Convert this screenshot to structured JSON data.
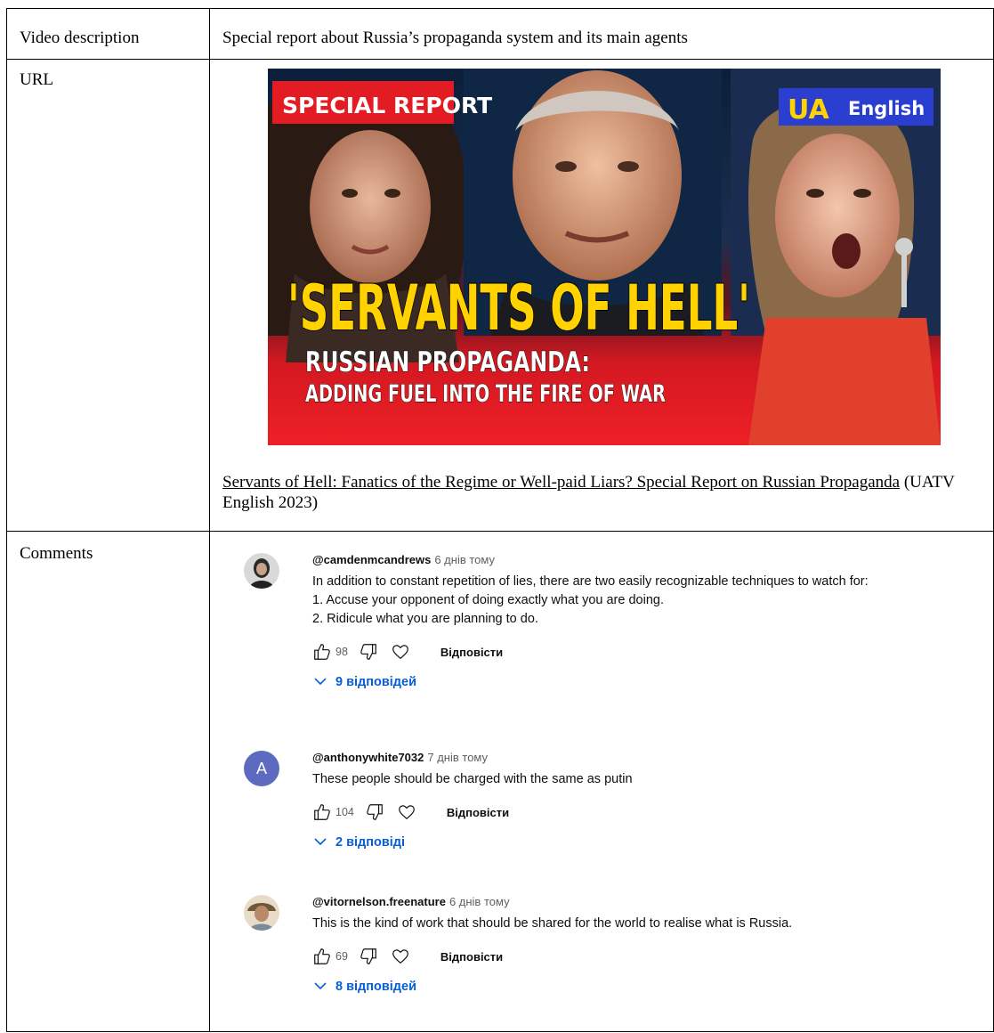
{
  "rows": {
    "description": {
      "label": "Video description",
      "value": "Special report about Russia’s propaganda system and its main agents"
    },
    "url": {
      "label": "URL",
      "thumbnail": {
        "badge": "SPECIAL REPORT",
        "logo_mark": "UA",
        "logo_text": "English",
        "headline": "'SERVANTS OF HELL'",
        "subline1": "RUSSIAN PROPAGANDA:",
        "subline2": "ADDING FUEL INTO THE FIRE OF WAR"
      },
      "citation_link": "Servants of Hell: Fanatics of the Regime or Well-paid Liars? Special Report on Russian Propaganda",
      "citation_rest": " (UATV English 2023)"
    },
    "comments": {
      "label": "Comments",
      "reply_label": "Відповісти",
      "items": [
        {
          "user": "@camdenmcandrews",
          "time": "6 днів тому",
          "lines": [
            "In addition to constant repetition of lies, there are two easily recognizable techniques to watch for:",
            "1. Accuse your opponent of doing exactly what you are doing.",
            "2. Ridicule what you are planning to do."
          ],
          "likes": "98",
          "replies": "9 відповідей"
        },
        {
          "user": "@anthonywhite7032",
          "time": "7 днів тому",
          "avatar_letter": "A",
          "lines": [
            "These people should be charged with the same as putin"
          ],
          "likes": "104",
          "replies": "2 відповіді"
        },
        {
          "user": "@vitornelson.freenature",
          "time": "6 днів тому",
          "lines": [
            "This is the kind of work that should be shared for the world to realise what is Russia."
          ],
          "likes": "69",
          "replies": "8 відповідей"
        }
      ]
    }
  },
  "colors": {
    "link_blue": "#065fd4",
    "avatar_blue": "#5c6bc0",
    "thumb_red": "#e31b23",
    "thumb_yellow": "#ffd200",
    "ua_logo_bg": "#2a3fd0"
  }
}
